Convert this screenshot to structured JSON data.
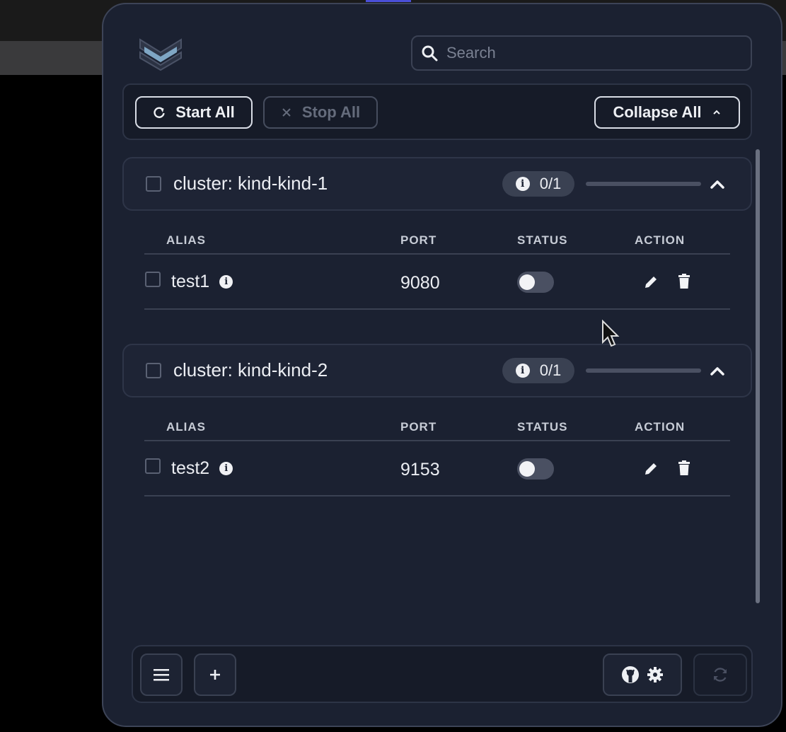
{
  "search": {
    "placeholder": "Search"
  },
  "toolbar": {
    "start_all": "Start All",
    "stop_all": "Stop All",
    "collapse_all": "Collapse All"
  },
  "table_headers": {
    "alias": "ALIAS",
    "port": "PORT",
    "status": "STATUS",
    "action": "ACTION"
  },
  "clusters": [
    {
      "name": "cluster: kind-kind-1",
      "count": "0/1",
      "progress": 0,
      "rows": [
        {
          "alias": "test1",
          "port": "9080",
          "status_on": false
        }
      ]
    },
    {
      "name": "cluster: kind-kind-2",
      "count": "0/1",
      "progress": 0,
      "rows": [
        {
          "alias": "test2",
          "port": "9153",
          "status_on": false
        }
      ]
    }
  ],
  "footer": {
    "icons": [
      "menu-icon",
      "plus-icon",
      "github-icon",
      "gear-icon",
      "refresh-icon"
    ]
  },
  "colors": {
    "panel_bg": "#1b2131",
    "border": "#3d4457",
    "text": "#e6e9f0",
    "muted": "#656c7c"
  }
}
